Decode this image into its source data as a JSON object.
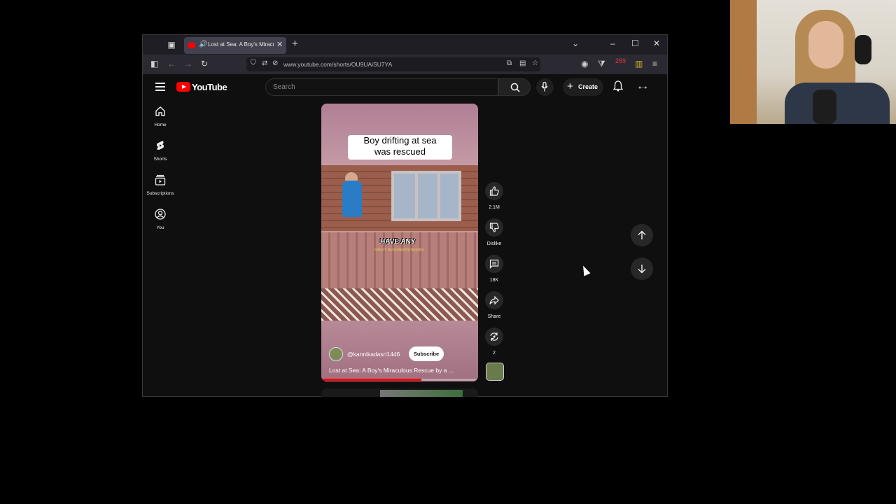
{
  "browser": {
    "tab_title": "Lost at Sea: A Boy's Miraculou",
    "url": "www.youtube.com/shorts/OU9UAiSU7YA",
    "extension_badge": "259"
  },
  "header": {
    "logo_text": "YouTube",
    "search_placeholder": "Search",
    "create_label": "Create"
  },
  "guide": {
    "items": [
      {
        "label": "Home",
        "icon": "home-icon"
      },
      {
        "label": "Shorts",
        "icon": "shorts-icon"
      },
      {
        "label": "Subscriptions",
        "icon": "subscriptions-icon"
      },
      {
        "label": "You",
        "icon": "you-icon"
      }
    ]
  },
  "short": {
    "caption_line1": "Boy drifting at sea",
    "caption_line2": "was rescued",
    "overlay_text": "HAVE ANY",
    "overlay_credit": "CREDIT: @JOJONESOUTDOORS",
    "channel": "@kannikadasri1446",
    "subscribe_label": "Subscribe",
    "title": "Lost at Sea: A Boy's Miraculous Rescue by a ...",
    "progress": 0.64
  },
  "actions": {
    "likes": "2.1M",
    "dislike_label": "Dislike",
    "comments": "18K",
    "share_label": "Share",
    "remix_count": "2"
  },
  "colors": {
    "brand_red": "#ff0000",
    "page_bg": "#0f0f0f"
  }
}
